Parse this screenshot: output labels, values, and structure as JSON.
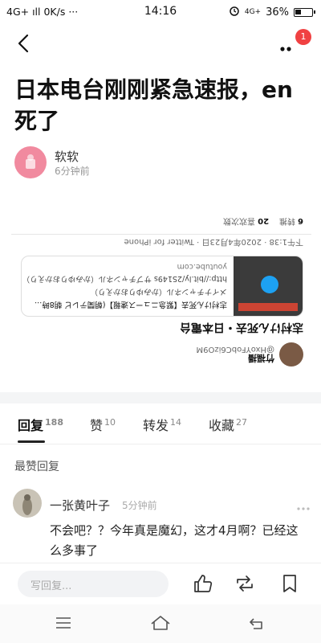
{
  "status_bar": {
    "left": "4G+ ıll 0K/s ···",
    "time": "14:16",
    "network": "4G+",
    "battery": "36%",
    "battery_level": 0.36
  },
  "nav": {
    "badge_count": "1"
  },
  "article": {
    "title": "日本电台刚刚紧急速报，en死了",
    "author_name": "软软",
    "author_time": "6分钟前"
  },
  "embed": {
    "user_name": "竹福播",
    "user_handle": "@HxoYFobC6izO9M",
    "headline": "志村けん死去・日本電台",
    "card_title": "志村けん死去【緊急ニュース速報】(朝聞テレビ 朝8時...",
    "card_subtitle": "メイナチャンネル（かみゆりおかえり）",
    "card_link": "http://bit.ly/2S149s  サブチャンネル（かみゆりおかえり）...",
    "card_domain": "youtube.com",
    "meta": "下午1:38 · 2020年4月23日 · Twitter for iPhone",
    "retweets_count": "6",
    "retweets_label": "转推",
    "likes_count": "20",
    "likes_label": "喜欢次数"
  },
  "tabs": [
    {
      "label": "回复",
      "count": "188"
    },
    {
      "label": "赞",
      "count": "10"
    },
    {
      "label": "转发",
      "count": "14"
    },
    {
      "label": "收藏",
      "count": "27"
    }
  ],
  "section_head": "最赞回复",
  "comment": {
    "name": "一张黄叶子",
    "time": "5分钟前",
    "text": "不会吧？？今年真是魔幻，这才4月啊？已经这么多事了"
  },
  "bottom_bar": {
    "reply_placeholder": "写回复..."
  },
  "icons": {
    "back": "back-arrow-icon",
    "more": "more-dots-icon",
    "like": "thumbs-up-icon",
    "share": "share-icon",
    "favorite": "bookmark-icon",
    "menu": "menu-icon",
    "home": "home-icon",
    "return": "return-icon"
  },
  "colors": {
    "badge": "#f04142",
    "avatar": "#f18a9f",
    "twitter_blue": "#1da1f2"
  }
}
